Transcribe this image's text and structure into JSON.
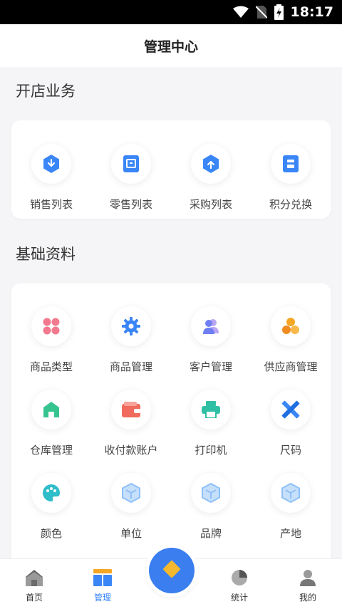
{
  "status_bar": {
    "time": "18:17"
  },
  "header": {
    "title": "管理中心"
  },
  "sections": [
    {
      "title": "开店业务",
      "items": [
        {
          "label": "销售列表",
          "icon": "download-hex-icon",
          "color": "#3a86f7"
        },
        {
          "label": "零售列表",
          "icon": "retail-doc-icon",
          "color": "#3a86f7"
        },
        {
          "label": "采购列表",
          "icon": "upload-hex-icon",
          "color": "#3a86f7"
        },
        {
          "label": "积分兑换",
          "icon": "points-doc-icon",
          "color": "#3a86f7"
        }
      ]
    },
    {
      "title": "基础资料",
      "items": [
        {
          "label": "商品类型",
          "icon": "category-grid-icon",
          "color": "#f27a8f"
        },
        {
          "label": "商品管理",
          "icon": "gear-icon",
          "color": "#3a86f7"
        },
        {
          "label": "客户管理",
          "icon": "customers-icon",
          "color": "#6f7ff2"
        },
        {
          "label": "供应商管理",
          "icon": "supplier-icon",
          "color": "#f5a623"
        },
        {
          "label": "仓库管理",
          "icon": "warehouse-icon",
          "color": "#35c38f"
        },
        {
          "label": "收付款账户",
          "icon": "wallet-icon",
          "color": "#f06b5e"
        },
        {
          "label": "打印机",
          "icon": "printer-icon",
          "color": "#2fbfa4"
        },
        {
          "label": "尺码",
          "icon": "ruler-pencil-icon",
          "color": "#3a86f7"
        },
        {
          "label": "颜色",
          "icon": "palette-icon",
          "color": "#2ebdc9"
        },
        {
          "label": "单位",
          "icon": "cube-icon",
          "color": "#8ec0f7"
        },
        {
          "label": "品牌",
          "icon": "cube-icon",
          "color": "#8ec0f7"
        },
        {
          "label": "产地",
          "icon": "cube-icon",
          "color": "#8ec0f7"
        }
      ]
    }
  ],
  "bottom_nav": {
    "items": [
      {
        "label": "首页",
        "icon": "home-icon",
        "active": false
      },
      {
        "label": "管理",
        "icon": "manage-icon",
        "active": true
      },
      {
        "label": "",
        "icon": "diamond-icon",
        "active": false
      },
      {
        "label": "统计",
        "icon": "stats-pie-icon",
        "active": false
      },
      {
        "label": "我的",
        "icon": "user-icon",
        "active": false
      }
    ]
  },
  "colors": {
    "accent": "#3a86f7",
    "background": "#f5f5f7"
  }
}
